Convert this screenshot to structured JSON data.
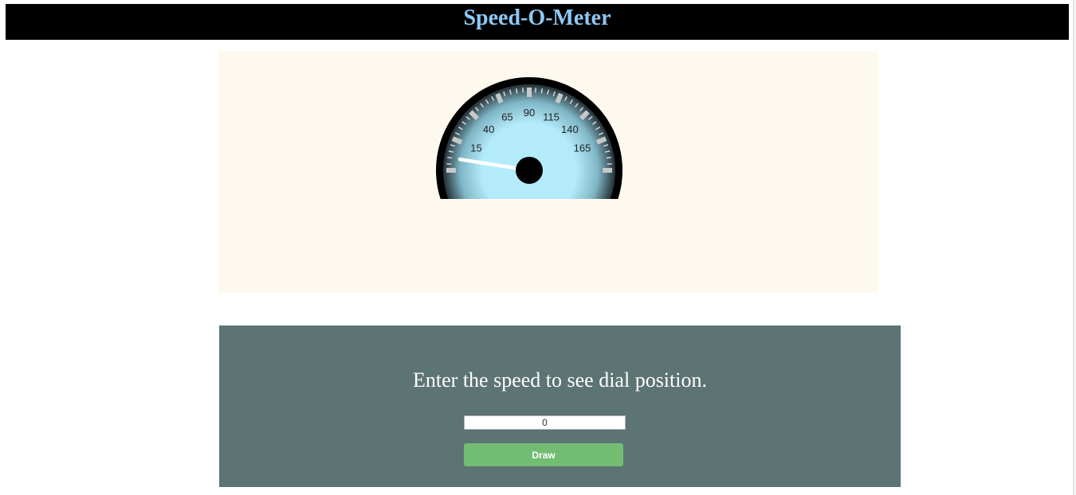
{
  "header": {
    "title": "Speed-O-Meter"
  },
  "gauge": {
    "speed": 0,
    "min_speed": -10,
    "max_speed": 190,
    "major_step": 25,
    "tick_labels": [
      "15",
      "40",
      "65",
      "90",
      "115",
      "140",
      "165"
    ]
  },
  "controls": {
    "prompt": "Enter the speed to see dial position.",
    "speed_value": "0",
    "draw_label": "Draw"
  },
  "colors": {
    "header_bg": "#000000",
    "title": "#8fc8f5",
    "canvas_bg": "#fdf9ee",
    "dial_face_center": "#b3ebfb",
    "dial_face_edge": "#243034",
    "panel_bg": "#5c7473",
    "button_bg": "#72bd72",
    "needle": "#ffffff"
  }
}
